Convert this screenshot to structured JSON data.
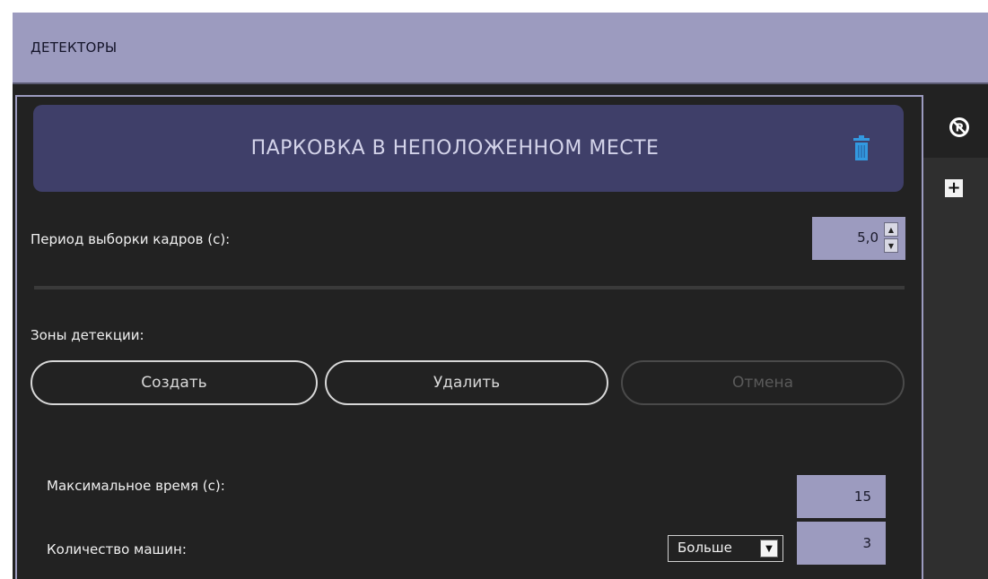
{
  "header": {
    "title": "ДЕТЕКТОРЫ"
  },
  "side_tabs": [
    {
      "icon": "no-parking-icon",
      "glyph": "⊘"
    },
    {
      "icon": "plus-icon",
      "glyph": "+"
    }
  ],
  "detector": {
    "title": "ПАРКОВКА В НЕПОЛОЖЕННОМ МЕСТЕ",
    "delete_icon": "trash-icon",
    "trash_color": "#3399e0"
  },
  "frame_period": {
    "label": "Период выборки кадров (с):",
    "value": "5,0"
  },
  "zones": {
    "label": "Зоны детекции:",
    "create_label": "Создать",
    "delete_label": "Удалить",
    "cancel_label": "Отмена"
  },
  "max_time": {
    "label": "Максимальное время (с):",
    "value": "15"
  },
  "car_count": {
    "label": "Количество машин:",
    "comparison": "Больше",
    "value": "3"
  },
  "colors": {
    "header_bg": "#9c9bbf",
    "panel_bg": "#222222",
    "title_bar_bg": "#3f3f69",
    "input_bg": "#9c9bbf"
  }
}
